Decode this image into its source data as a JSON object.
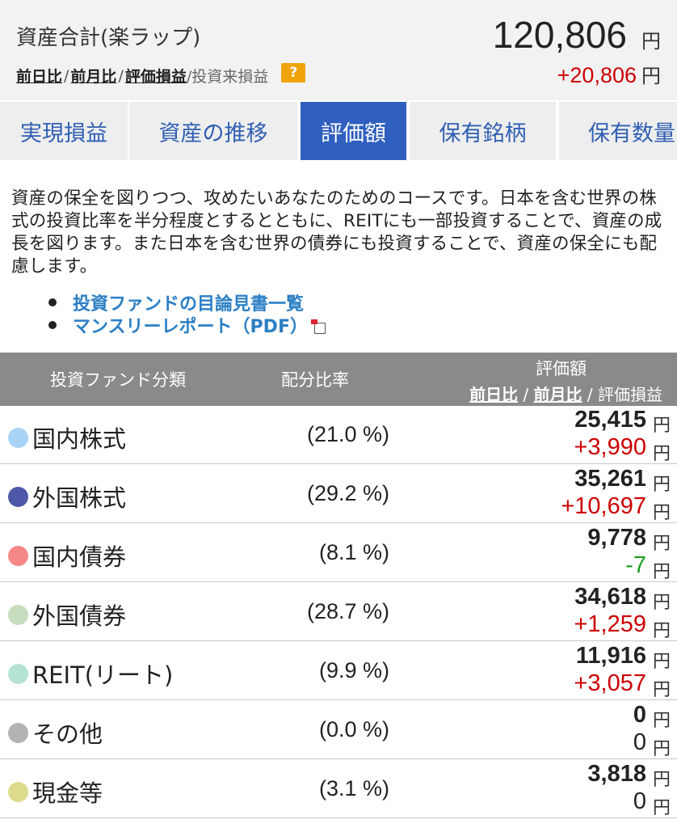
{
  "summary": {
    "title": "資産合計(楽ラップ)",
    "total": "120,806",
    "unit": "円",
    "diff": "+20,806",
    "diff_unit": "円",
    "links": {
      "day": "前日比",
      "month": "前月比",
      "gain": "評価損益",
      "since": "/投資来損益",
      "sep": "/"
    },
    "help": "?"
  },
  "tabs": [
    {
      "label": "実現損益"
    },
    {
      "label": "資産の推移"
    },
    {
      "label": "評価額"
    },
    {
      "label": "保有銘柄"
    },
    {
      "label": "保有数量"
    }
  ],
  "description": "資産の保全を図りつつ、攻めたいあなたのためのコースです。日本を含む世界の株式の投資比率を半分程度とするとともに、REITにも一部投資することで、資産の成長を図ります。また日本を含む世界の債券にも投資することで、資産の保全にも配慮します。",
  "bullets": [
    {
      "label": "投資ファンドの目論見書一覧"
    },
    {
      "label": "マンスリーレポート（PDF）"
    }
  ],
  "table": {
    "header": {
      "category": "投資ファンド分類",
      "ratio": "配分比率",
      "value": "評価額",
      "sub_day": "前日比",
      "sub_month": "前月比",
      "sub_gain": "評価損益",
      "sep": " / "
    },
    "rows": [
      {
        "category": "国内株式",
        "ratio": "(21.0 %)",
        "value": "25,415",
        "change": "+3,990",
        "unit": "円",
        "color": "#a9d3f5",
        "sign": "pos"
      },
      {
        "category": "外国株式",
        "ratio": "(29.2 %)",
        "value": "35,261",
        "change": "+10,697",
        "unit": "円",
        "color": "#4d58a8",
        "sign": "pos"
      },
      {
        "category": "国内債券",
        "ratio": "(8.1 %)",
        "value": "9,778",
        "change": "-7",
        "unit": "円",
        "color": "#f68787",
        "sign": "neg"
      },
      {
        "category": "外国債券",
        "ratio": "(28.7 %)",
        "value": "34,618",
        "change": "+1,259",
        "unit": "円",
        "color": "#c8dcbe",
        "sign": "pos"
      },
      {
        "category": "REIT(リート)",
        "ratio": "(9.9 %)",
        "value": "11,916",
        "change": "+3,057",
        "unit": "円",
        "color": "#b4e2d4",
        "sign": "pos"
      },
      {
        "category": "その他",
        "ratio": "(0.0 %)",
        "value": "0",
        "change": "0",
        "unit": "円",
        "color": "#b3b3b3",
        "sign": "zero"
      },
      {
        "category": "現金等",
        "ratio": "(3.1 %)",
        "value": "3,818",
        "change": "0",
        "unit": "円",
        "color": "#dcdc8c",
        "sign": "zero"
      }
    ]
  }
}
